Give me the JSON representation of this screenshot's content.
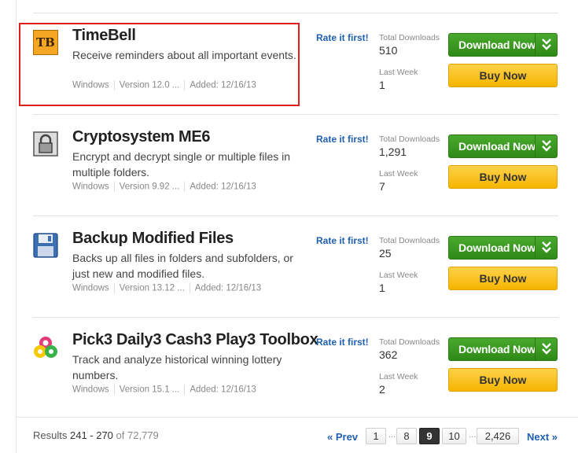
{
  "items": [
    {
      "title": "TimeBell",
      "description": "Receive reminders about all important events.",
      "platform": "Windows",
      "version": "Version 12.0 ...",
      "added": "Added: 12/16/13",
      "rate_label": "Rate it first!",
      "total_downloads_label": "Total Downloads",
      "total_downloads": "510",
      "last_week_label": "Last Week",
      "last_week": "1",
      "download_label": "Download Now",
      "buy_label": "Buy Now",
      "icon": "timebell-app-icon",
      "icon_text": "TB"
    },
    {
      "title": "Cryptosystem ME6",
      "description": "Encrypt and decrypt single or multiple files in multiple folders.",
      "platform": "Windows",
      "version": "Version 9.92 ...",
      "added": "Added: 12/16/13",
      "rate_label": "Rate it first!",
      "total_downloads_label": "Total Downloads",
      "total_downloads": "1,291",
      "last_week_label": "Last Week",
      "last_week": "7",
      "download_label": "Download Now",
      "buy_label": "Buy Now",
      "icon": "padlock-icon"
    },
    {
      "title": "Backup Modified Files",
      "description": "Backs up all files in folders and subfolders, or just new and modified files.",
      "platform": "Windows",
      "version": "Version 13.12 ...",
      "added": "Added: 12/16/13",
      "rate_label": "Rate it first!",
      "total_downloads_label": "Total Downloads",
      "total_downloads": "25",
      "last_week_label": "Last Week",
      "last_week": "1",
      "download_label": "Download Now",
      "buy_label": "Buy Now",
      "icon": "floppy-disk-icon"
    },
    {
      "title": "Pick3 Daily3 Cash3 Play3 Toolbox",
      "description": "Track and analyze historical winning lottery numbers.",
      "platform": "Windows",
      "version": "Version 15.1 ...",
      "added": "Added: 12/16/13",
      "rate_label": "Rate it first!",
      "total_downloads_label": "Total Downloads",
      "total_downloads": "362",
      "last_week_label": "Last Week",
      "last_week": "2",
      "download_label": "Download Now",
      "buy_label": "Buy Now",
      "icon": "lottery-balls-icon"
    }
  ],
  "footer": {
    "results_prefix": "Results",
    "results_range": "241 - 270",
    "results_of": "of",
    "results_total": "72,779"
  },
  "pagination": {
    "prev": "« Prev",
    "pages": [
      "1",
      "8",
      "9",
      "10",
      "2,426"
    ],
    "current": "9",
    "ellipsis": "...",
    "next": "Next »"
  },
  "colors": {
    "download_green": "#2f8a17",
    "buy_yellow": "#f5b400",
    "link_blue": "#2060b0",
    "highlight_red": "#e0201e"
  }
}
